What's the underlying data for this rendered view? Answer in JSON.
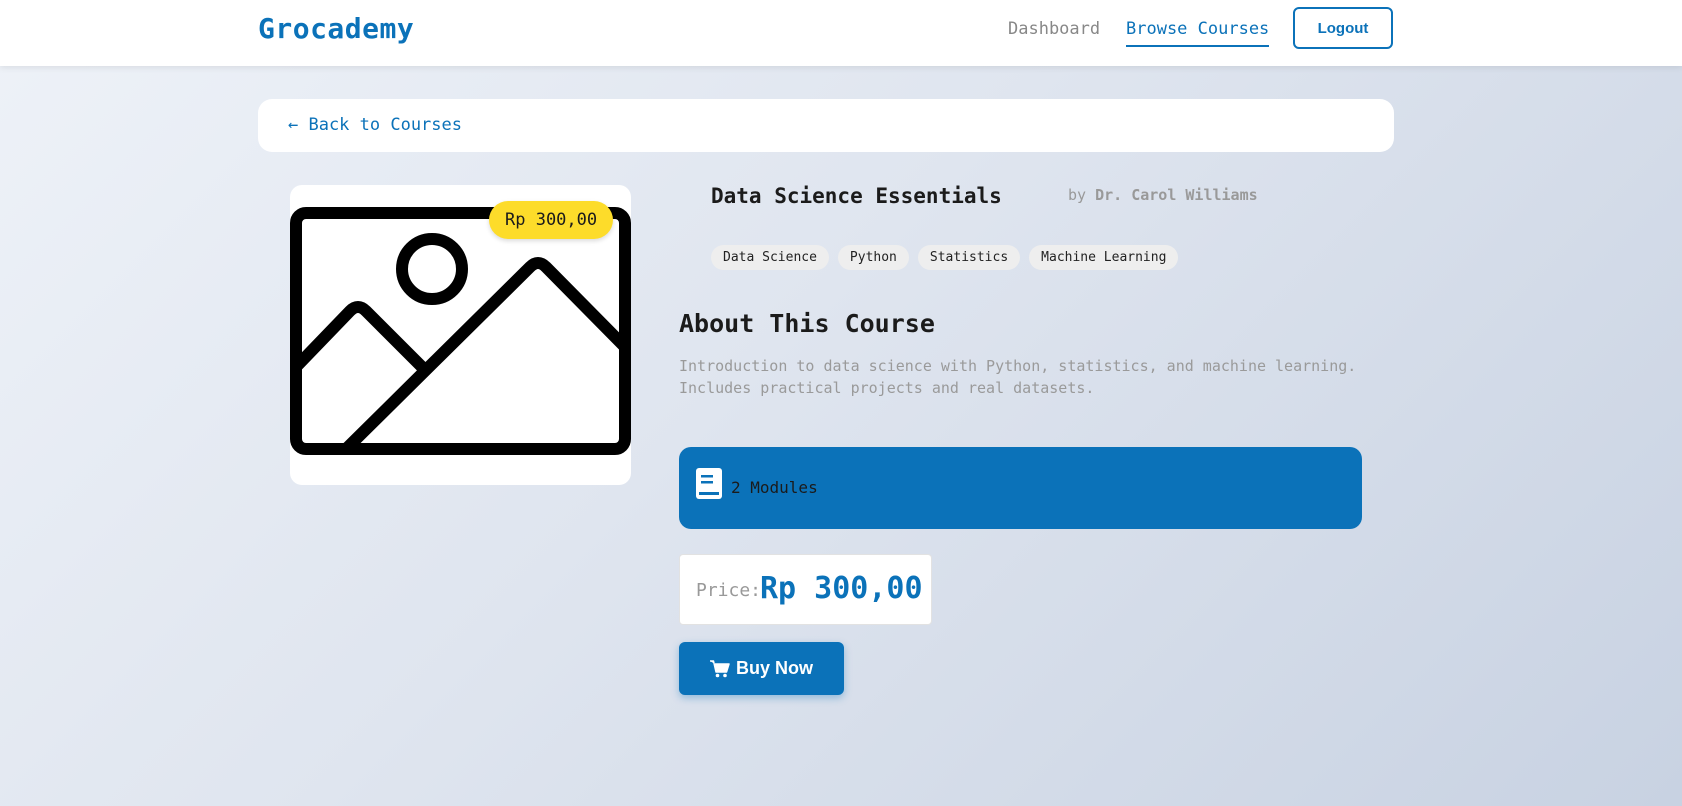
{
  "nav": {
    "brand": "Grocademy",
    "dashboard": "Dashboard",
    "browse": "Browse Courses",
    "logout": "Logout"
  },
  "back_link": "← Back to Courses",
  "course": {
    "title": "Data Science Essentials",
    "by": "by",
    "instructor": "Dr. Carol Williams",
    "price_badge": "Rp 300,00",
    "tags": [
      "Data Science",
      "Python",
      "Statistics",
      "Machine Learning"
    ],
    "thumbnail_icon": "image-placeholder-icon"
  },
  "about": {
    "title": "About This Course",
    "description": "Introduction to data science with Python, statistics, and machine learning. Includes practical projects and real datasets."
  },
  "modules": {
    "icon": "book-icon",
    "text": "2 Modules"
  },
  "price": {
    "label": "Price:",
    "value": "Rp 300,00"
  },
  "buy": {
    "icon": "cart-icon",
    "label": "Buy Now"
  },
  "colors": {
    "primary": "#0b72b9",
    "badge": "#fddc2a"
  }
}
